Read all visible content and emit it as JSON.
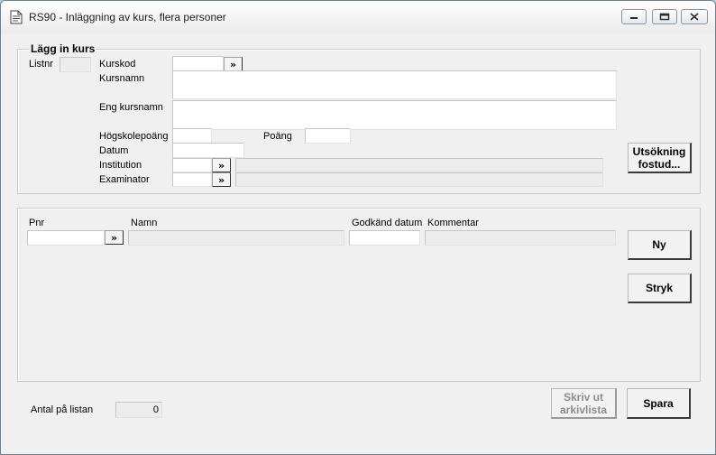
{
  "window": {
    "title": "RS90 - Inläggning av kurs, flera personer"
  },
  "course_group": {
    "legend": "Lägg in kurs",
    "listnr_label": "Listnr",
    "kurskod_label": "Kurskod",
    "kursnamn_label": "Kursnamn",
    "eng_kursnamn_label": "Eng kursnamn",
    "hogskolepoang_label": "Högskolepoäng",
    "poang_label": "Poäng",
    "datum_label": "Datum",
    "institution_label": "Institution",
    "examinator_label": "Examinator",
    "lookup_glyph": "»",
    "utsokning_line1": "Utsökning",
    "utsokning_line2": "fostud..."
  },
  "person_group": {
    "pnr_label": "Pnr",
    "namn_label": "Namn",
    "godkand_label": "Godkänd datum",
    "kommentar_label": "Kommentar",
    "ny_label": "Ny",
    "stryk_label": "Stryk"
  },
  "footer": {
    "antal_label": "Antal på listan",
    "antal_value": "0",
    "skriv_line1": "Skriv ut",
    "skriv_line2": "arkivlista",
    "spara_label": "Spara"
  }
}
